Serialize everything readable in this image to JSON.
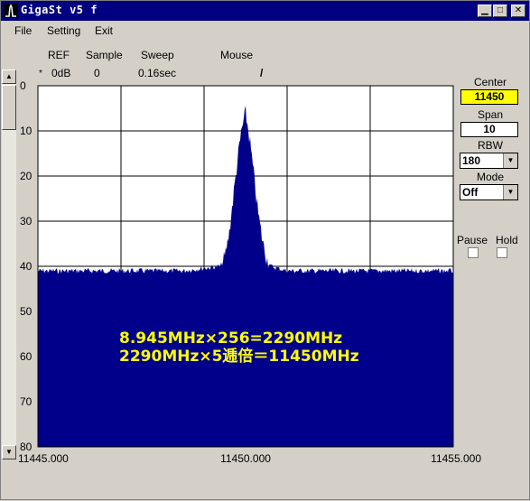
{
  "window": {
    "title": "GigaSt v5 f"
  },
  "titlebar_buttons": {
    "minimize_icon": "minimize-icon",
    "maximize_icon": "maximize-icon",
    "close_icon": "close-icon"
  },
  "menu": [
    "File",
    "Setting",
    "Exit"
  ],
  "header": {
    "labels": [
      "REF",
      "Sample",
      "Sweep",
      "Mouse"
    ],
    "ref_value": "0dB",
    "ref_marker": "*",
    "sample_value": "0",
    "sweep_value": "0.16sec",
    "mouse_value": "/"
  },
  "right_panel": {
    "center_label": "Center",
    "center_value": "11450",
    "span_label": "Span",
    "span_value": "10",
    "rbw_label": "RBW",
    "rbw_value": "180",
    "mode_label": "Mode",
    "mode_value": "Off",
    "pause_label": "Pause",
    "hold_label": "Hold"
  },
  "colors": {
    "plot_bg": "#ffffff",
    "trace": "#00008b",
    "center_bg": "#ffff00",
    "annotation": "#ffff00"
  },
  "chart_data": {
    "type": "area",
    "y_ticks": [
      "0",
      "10",
      "20",
      "30",
      "40",
      "50",
      "60",
      "70",
      "80"
    ],
    "x_ticks": [
      "11445.000",
      "11450.000",
      "11455.000"
    ],
    "xlim": [
      11445.0,
      11455.0
    ],
    "ylim": [
      0,
      80
    ],
    "y_inverted": true,
    "grid": true,
    "noise_floor": 41,
    "peak": {
      "x": 11450.0,
      "y": 6
    },
    "series": [
      {
        "x": [
          11445.0,
          11448.5,
          11449.4,
          11449.5,
          11449.6,
          11449.7,
          11449.8,
          11449.9,
          11450.0,
          11450.1,
          11450.2,
          11450.3,
          11450.4,
          11450.5,
          11450.6,
          11451.0,
          11455.0
        ],
        "values": [
          41,
          41,
          40,
          38,
          33,
          25,
          17,
          10,
          6,
          12,
          20,
          28,
          34,
          38,
          40,
          41,
          41
        ]
      }
    ],
    "annotations": [
      "8.945MHz×256=2290MHz",
      "2290MHz×5逓倍＝11450MHz"
    ]
  }
}
